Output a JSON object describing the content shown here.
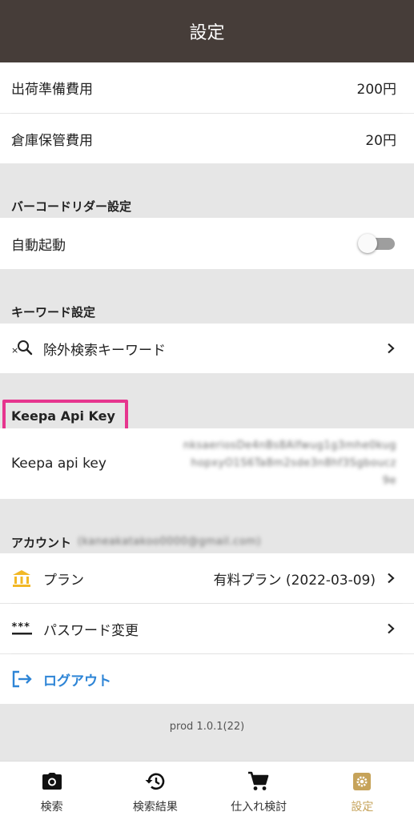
{
  "header": {
    "title": "設定"
  },
  "costs": [
    {
      "label": "出荷準備費用",
      "value": "200円"
    },
    {
      "label": "倉庫保管費用",
      "value": "20円"
    }
  ],
  "barcode": {
    "section_title": "バーコードリダー設定",
    "auto_start_label": "自動起動",
    "auto_start_enabled": false
  },
  "keywords": {
    "section_title": "キーワード設定",
    "exclude_label": "除外検索キーワード"
  },
  "keepa": {
    "section_title": "Keepa Api Key",
    "field_label": "Keepa api key",
    "value_lines": [
      "nksaeriosDe4nBs8Alfwug1g3mhe0kug",
      "hopxyO1S6Ta8m2sde3n8hf3Sgboucz",
      "9e"
    ]
  },
  "account": {
    "section_title": "アカウント",
    "email": "(kaneakatakoo0000@gmail.com)",
    "plan_label": "プラン",
    "plan_value": "有料プラン (2022-03-09)",
    "password_label": "パスワード変更",
    "logout_label": "ログアウト"
  },
  "version": "prod 1.0.1(22)",
  "tabs": [
    {
      "label": "検索",
      "icon": "camera-icon"
    },
    {
      "label": "検索結果",
      "icon": "history-icon"
    },
    {
      "label": "仕入れ検討",
      "icon": "cart-icon"
    },
    {
      "label": "設定",
      "icon": "gear-icon",
      "active": true
    }
  ],
  "colors": {
    "header_bg": "#463d39",
    "accent_gold": "#c6a35a",
    "link_blue": "#2e85d6",
    "highlight_pink": "#e6358e",
    "plan_icon_yellow": "#f2b826"
  }
}
